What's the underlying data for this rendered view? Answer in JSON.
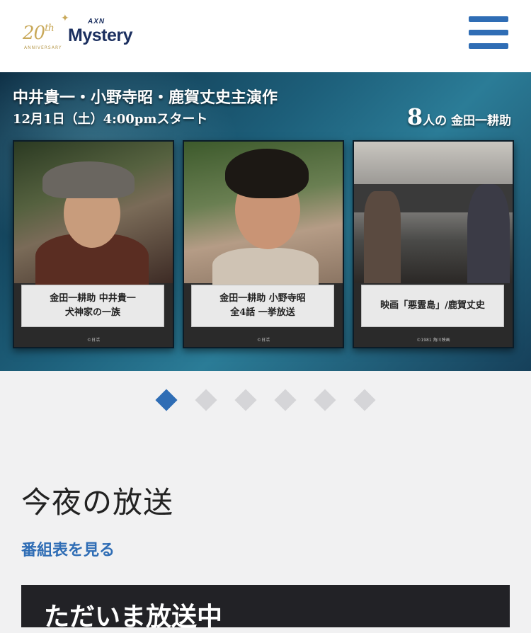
{
  "header": {
    "logo": {
      "anniversary_number": "20",
      "anniversary_suffix": "th",
      "anniversary_label": "ANNIVERSARY",
      "channel_small": "AXN",
      "channel_name": "Mystery"
    },
    "menu_icon": "hamburger-menu-icon"
  },
  "banner": {
    "title": "中井貴一・小野寺昭・鹿賀丈史主演作",
    "date": "12月1日（土）4:00pmスタート",
    "badge_number": "8",
    "badge_text": "人の 金田一耕助",
    "cards": [
      {
        "line1": "金田一耕助 中井貴一",
        "line2": "犬神家の一族",
        "copyright": "©日活"
      },
      {
        "line1": "金田一耕助 小野寺昭",
        "line2": "全4話 一挙放送",
        "copyright": "©日活"
      },
      {
        "line1": "映画「悪霊島」/鹿賀丈史",
        "line2": "",
        "copyright": "©1981 角川映画"
      }
    ]
  },
  "carousel": {
    "total": 6,
    "active_index": 0
  },
  "tonight": {
    "title": "今夜の放送",
    "schedule_link": "番組表を見る",
    "now_on_air": "ただいま放送中"
  },
  "colors": {
    "accent": "#2f6db5",
    "background": "#f1f1f2",
    "dark_box": "#222226"
  }
}
